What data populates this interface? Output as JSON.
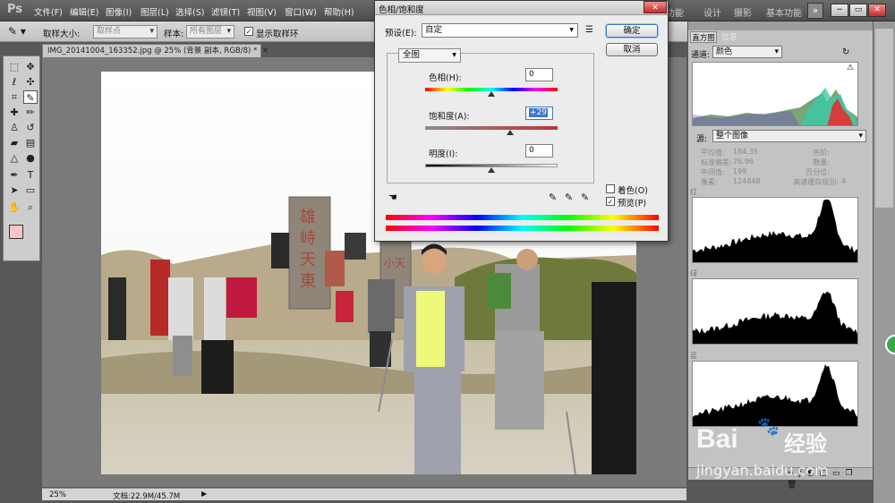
{
  "app": {
    "logo": "Ps"
  },
  "menu": [
    "文件(F)",
    "编辑(E)",
    "图像(I)",
    "图层(L)",
    "选择(S)",
    "滤镜(T)",
    "视图(V)",
    "窗口(W)",
    "帮助(H)"
  ],
  "workspaces": [
    "功能",
    "设计",
    "摄影",
    "基本功能"
  ],
  "workspace_more": "»",
  "window_controls": [
    "−",
    "▭",
    "✕"
  ],
  "options": {
    "tool_icon": "eyedropper-icon",
    "sample_size_label": "取样大小:",
    "sample_size_value": "取样点",
    "sample_label": "样本:",
    "sample_value": "所有图层",
    "ring_checkbox": "✓",
    "ring_label": "显示取样环"
  },
  "document": {
    "tab_title": "IMG_20141004_163352.jpg @ 25% (背景 副本, RGB/8) *",
    "tab_close": "✕"
  },
  "status": {
    "zoom": "25%",
    "doc_info": "文档:22.9M/45.7M"
  },
  "dialog": {
    "title": "色相/饱和度",
    "preset_label": "预设(E):",
    "preset_value": "自定",
    "channel_value": "全图",
    "hue_label": "色相(H):",
    "hue_value": "0",
    "saturation_label": "饱和度(A):",
    "saturation_value": "+29",
    "lightness_label": "明度(I):",
    "lightness_value": "0",
    "ok": "确定",
    "cancel": "取消",
    "colorize_label": "着色(O)",
    "colorize_checked": false,
    "preview_label": "预览(P)",
    "preview_checked": true,
    "preview_check_mark": "✓",
    "hue_slider_fraction": 0.5,
    "saturation_slider_fraction": 0.645,
    "lightness_slider_fraction": 0.5
  },
  "panel": {
    "tabs": [
      "直方图",
      "信息"
    ],
    "channel_label": "通道:",
    "channel_value": "颜色",
    "source_label": "源:",
    "source_value": "整个图像",
    "stats_left": [
      {
        "label": "平均值:",
        "value": "184.35"
      },
      {
        "label": "标准偏差:",
        "value": "76.96"
      },
      {
        "label": "中间值:",
        "value": "199"
      },
      {
        "label": "像素:",
        "value": "124848"
      }
    ],
    "stats_right": [
      {
        "label": "色阶:",
        "value": ""
      },
      {
        "label": "数量:",
        "value": ""
      },
      {
        "label": "百分位:",
        "value": ""
      },
      {
        "label": "高速缓存级别:",
        "value": "4"
      }
    ],
    "channels": [
      "红",
      "绿",
      "蓝"
    ]
  },
  "photo": {
    "carving_1": "雄峙天東",
    "carving_2": "小天"
  },
  "watermark": {
    "brand_a": "Bai",
    "brand_b": "经验",
    "url": "jingyan.baidu.com"
  },
  "colors": {
    "foreground": "#f9c4c4",
    "background": "#e8120c",
    "dialog_bg": "#ececec"
  }
}
